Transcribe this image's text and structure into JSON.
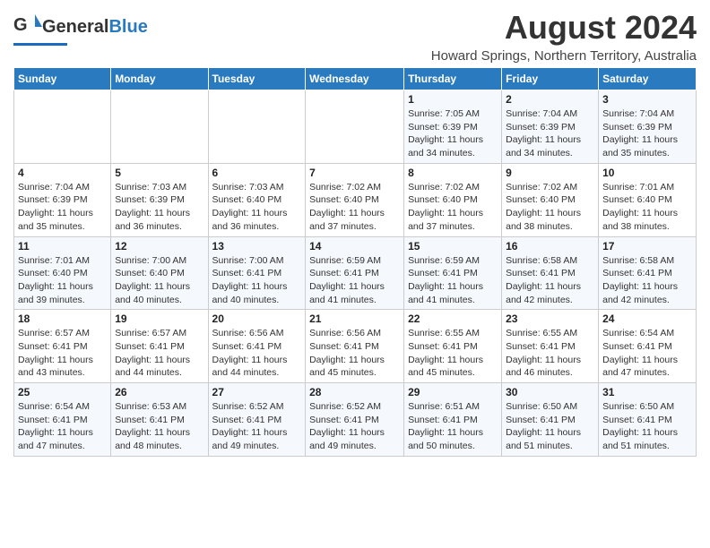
{
  "header": {
    "logo_general": "General",
    "logo_blue": "Blue",
    "main_title": "August 2024",
    "sub_title": "Howard Springs, Northern Territory, Australia"
  },
  "calendar": {
    "days_of_week": [
      "Sunday",
      "Monday",
      "Tuesday",
      "Wednesday",
      "Thursday",
      "Friday",
      "Saturday"
    ],
    "weeks": [
      [
        {
          "day": "",
          "info": ""
        },
        {
          "day": "",
          "info": ""
        },
        {
          "day": "",
          "info": ""
        },
        {
          "day": "",
          "info": ""
        },
        {
          "day": "1",
          "info": "Sunrise: 7:05 AM\nSunset: 6:39 PM\nDaylight: 11 hours\nand 34 minutes."
        },
        {
          "day": "2",
          "info": "Sunrise: 7:04 AM\nSunset: 6:39 PM\nDaylight: 11 hours\nand 34 minutes."
        },
        {
          "day": "3",
          "info": "Sunrise: 7:04 AM\nSunset: 6:39 PM\nDaylight: 11 hours\nand 35 minutes."
        }
      ],
      [
        {
          "day": "4",
          "info": "Sunrise: 7:04 AM\nSunset: 6:39 PM\nDaylight: 11 hours\nand 35 minutes."
        },
        {
          "day": "5",
          "info": "Sunrise: 7:03 AM\nSunset: 6:39 PM\nDaylight: 11 hours\nand 36 minutes."
        },
        {
          "day": "6",
          "info": "Sunrise: 7:03 AM\nSunset: 6:40 PM\nDaylight: 11 hours\nand 36 minutes."
        },
        {
          "day": "7",
          "info": "Sunrise: 7:02 AM\nSunset: 6:40 PM\nDaylight: 11 hours\nand 37 minutes."
        },
        {
          "day": "8",
          "info": "Sunrise: 7:02 AM\nSunset: 6:40 PM\nDaylight: 11 hours\nand 37 minutes."
        },
        {
          "day": "9",
          "info": "Sunrise: 7:02 AM\nSunset: 6:40 PM\nDaylight: 11 hours\nand 38 minutes."
        },
        {
          "day": "10",
          "info": "Sunrise: 7:01 AM\nSunset: 6:40 PM\nDaylight: 11 hours\nand 38 minutes."
        }
      ],
      [
        {
          "day": "11",
          "info": "Sunrise: 7:01 AM\nSunset: 6:40 PM\nDaylight: 11 hours\nand 39 minutes."
        },
        {
          "day": "12",
          "info": "Sunrise: 7:00 AM\nSunset: 6:40 PM\nDaylight: 11 hours\nand 40 minutes."
        },
        {
          "day": "13",
          "info": "Sunrise: 7:00 AM\nSunset: 6:41 PM\nDaylight: 11 hours\nand 40 minutes."
        },
        {
          "day": "14",
          "info": "Sunrise: 6:59 AM\nSunset: 6:41 PM\nDaylight: 11 hours\nand 41 minutes."
        },
        {
          "day": "15",
          "info": "Sunrise: 6:59 AM\nSunset: 6:41 PM\nDaylight: 11 hours\nand 41 minutes."
        },
        {
          "day": "16",
          "info": "Sunrise: 6:58 AM\nSunset: 6:41 PM\nDaylight: 11 hours\nand 42 minutes."
        },
        {
          "day": "17",
          "info": "Sunrise: 6:58 AM\nSunset: 6:41 PM\nDaylight: 11 hours\nand 42 minutes."
        }
      ],
      [
        {
          "day": "18",
          "info": "Sunrise: 6:57 AM\nSunset: 6:41 PM\nDaylight: 11 hours\nand 43 minutes."
        },
        {
          "day": "19",
          "info": "Sunrise: 6:57 AM\nSunset: 6:41 PM\nDaylight: 11 hours\nand 44 minutes."
        },
        {
          "day": "20",
          "info": "Sunrise: 6:56 AM\nSunset: 6:41 PM\nDaylight: 11 hours\nand 44 minutes."
        },
        {
          "day": "21",
          "info": "Sunrise: 6:56 AM\nSunset: 6:41 PM\nDaylight: 11 hours\nand 45 minutes."
        },
        {
          "day": "22",
          "info": "Sunrise: 6:55 AM\nSunset: 6:41 PM\nDaylight: 11 hours\nand 45 minutes."
        },
        {
          "day": "23",
          "info": "Sunrise: 6:55 AM\nSunset: 6:41 PM\nDaylight: 11 hours\nand 46 minutes."
        },
        {
          "day": "24",
          "info": "Sunrise: 6:54 AM\nSunset: 6:41 PM\nDaylight: 11 hours\nand 47 minutes."
        }
      ],
      [
        {
          "day": "25",
          "info": "Sunrise: 6:54 AM\nSunset: 6:41 PM\nDaylight: 11 hours\nand 47 minutes."
        },
        {
          "day": "26",
          "info": "Sunrise: 6:53 AM\nSunset: 6:41 PM\nDaylight: 11 hours\nand 48 minutes."
        },
        {
          "day": "27",
          "info": "Sunrise: 6:52 AM\nSunset: 6:41 PM\nDaylight: 11 hours\nand 49 minutes."
        },
        {
          "day": "28",
          "info": "Sunrise: 6:52 AM\nSunset: 6:41 PM\nDaylight: 11 hours\nand 49 minutes."
        },
        {
          "day": "29",
          "info": "Sunrise: 6:51 AM\nSunset: 6:41 PM\nDaylight: 11 hours\nand 50 minutes."
        },
        {
          "day": "30",
          "info": "Sunrise: 6:50 AM\nSunset: 6:41 PM\nDaylight: 11 hours\nand 51 minutes."
        },
        {
          "day": "31",
          "info": "Sunrise: 6:50 AM\nSunset: 6:41 PM\nDaylight: 11 hours\nand 51 minutes."
        }
      ]
    ]
  }
}
